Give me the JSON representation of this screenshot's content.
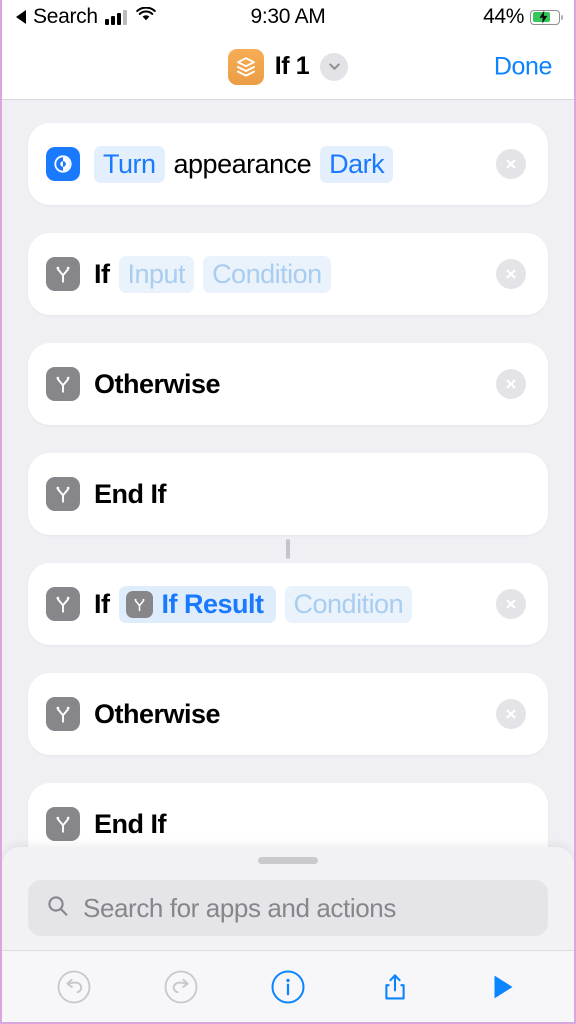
{
  "status_bar": {
    "back_label": "Search",
    "back_icon": "back-triangle-icon",
    "signal_icon": "cellular-signal-icon",
    "wifi_icon": "wifi-icon",
    "time": "9:30 AM",
    "battery_percent": "44%",
    "battery_icon": "battery-charging-icon"
  },
  "nav_bar": {
    "app_icon": "shortcuts-layers-icon",
    "title": "If 1",
    "chevron_icon": "chevron-down-icon",
    "done_label": "Done",
    "accent_color": "#0a84ff",
    "app_icon_color": "#f0a252"
  },
  "actions": [
    {
      "id": "set-appearance",
      "icon": "appearance-contrast-icon",
      "icon_style": "blue",
      "parts": [
        {
          "type": "pill_filled",
          "text": "Turn"
        },
        {
          "type": "plain",
          "text": "appearance"
        },
        {
          "type": "pill_filled",
          "text": "Dark"
        }
      ],
      "has_close": true,
      "close_icon": "close-circle-icon",
      "connector_above": false
    },
    {
      "id": "if-input-condition",
      "icon": "branch-if-icon",
      "icon_style": "gray",
      "parts": [
        {
          "type": "bold",
          "text": "If"
        },
        {
          "type": "gap"
        },
        {
          "type": "pill_placeholder",
          "text": "Input"
        },
        {
          "type": "gap"
        },
        {
          "type": "pill_placeholder",
          "text": "Condition"
        }
      ],
      "has_close": true,
      "close_icon": "close-circle-icon",
      "connector_above": false
    },
    {
      "id": "otherwise-1",
      "icon": "branch-if-icon",
      "icon_style": "gray",
      "parts": [
        {
          "type": "bold",
          "text": "Otherwise"
        }
      ],
      "has_close": true,
      "close_icon": "close-circle-icon",
      "connector_above": false
    },
    {
      "id": "end-if-1",
      "icon": "branch-if-icon",
      "icon_style": "gray",
      "parts": [
        {
          "type": "bold",
          "text": "End If"
        }
      ],
      "has_close": false,
      "connector_above": false
    },
    {
      "id": "if-ifresult-condition",
      "icon": "branch-if-icon",
      "icon_style": "gray",
      "parts": [
        {
          "type": "bold",
          "text": "If"
        },
        {
          "type": "gap"
        },
        {
          "type": "pill_token",
          "text": "If Result",
          "token_icon": "branch-if-icon"
        },
        {
          "type": "gap"
        },
        {
          "type": "pill_placeholder",
          "text": "Condition"
        }
      ],
      "has_close": true,
      "close_icon": "close-circle-icon",
      "connector_above": true
    },
    {
      "id": "otherwise-2",
      "icon": "branch-if-icon",
      "icon_style": "gray",
      "parts": [
        {
          "type": "bold",
          "text": "Otherwise"
        }
      ],
      "has_close": true,
      "close_icon": "close-circle-icon",
      "connector_above": false
    },
    {
      "id": "end-if-2",
      "icon": "branch-if-icon",
      "icon_style": "gray",
      "parts": [
        {
          "type": "bold",
          "text": "End If"
        }
      ],
      "has_close": false,
      "connector_above": false
    }
  ],
  "sheet": {
    "grabber": "drag-handle",
    "search": {
      "icon": "search-icon",
      "placeholder": "Search for apps and actions",
      "value": ""
    }
  },
  "toolbar": {
    "buttons": [
      {
        "id": "undo",
        "icon": "undo-icon",
        "label": "Undo",
        "enabled": false
      },
      {
        "id": "redo",
        "icon": "redo-icon",
        "label": "Redo",
        "enabled": false
      },
      {
        "id": "info",
        "icon": "info-circle-icon",
        "label": "Info",
        "enabled": true
      },
      {
        "id": "share",
        "icon": "share-icon",
        "label": "Share",
        "enabled": true
      },
      {
        "id": "run",
        "icon": "play-icon",
        "label": "Run",
        "enabled": true
      }
    ],
    "disabled_color": "#c7c7cc",
    "enabled_color": "#0a84ff"
  }
}
